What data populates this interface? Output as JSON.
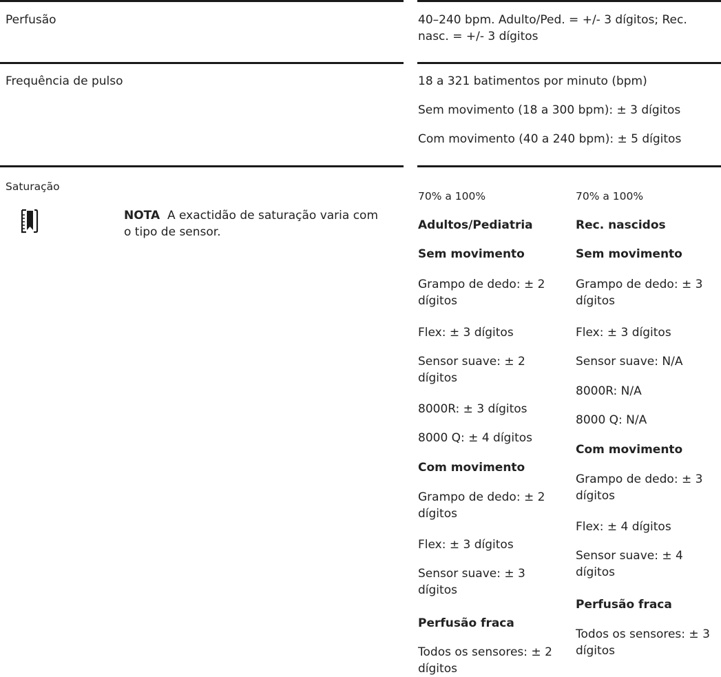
{
  "rows": {
    "perfusion": {
      "label": "Perfusão",
      "value": [
        "40–240 bpm. Adulto/Ped. = +/- 3 dígitos; Rec.",
        "nasc. = +/- 3 dígitos"
      ]
    },
    "pulse": {
      "label": "Frequência de pulso",
      "values": [
        "18 a 321 batimentos por minuto (bpm)",
        "Sem movimento (18 a 300 bpm): ± 3 dígitos",
        "Com movimento (40 a 240 bpm): ± 5 dígitos"
      ]
    },
    "saturation": {
      "label": "Saturação",
      "note": {
        "icon": "note-book-icon",
        "keyword": "NOTA",
        "text_line1": "A exactidão de saturação varia com",
        "text_line2": "o tipo de sensor."
      },
      "adult": {
        "range": "70% a 100%",
        "heading": "Adultos/Pediatria",
        "no_motion": {
          "heading": "Sem movimento",
          "finger_clip": [
            "Grampo de dedo: ± 2",
            "dígitos"
          ],
          "flex": "Flex: ± 3 dígitos",
          "soft_sensor": [
            "Sensor suave: ± 2",
            "dígitos"
          ],
          "r8000": "8000R: ± 3 dígitos",
          "q8000": "8000 Q: ± 4 dígitos"
        },
        "motion": {
          "heading": "Com movimento",
          "finger_clip": [
            "Grampo de dedo: ± 2",
            "dígitos"
          ],
          "flex": "Flex: ± 3 dígitos",
          "soft_sensor": [
            "Sensor suave: ± 3",
            "dígitos"
          ]
        },
        "low_perfusion": {
          "heading": "Perfusão fraca",
          "all_sensors": [
            "Todos os sensores: ± 2",
            "dígitos"
          ]
        }
      },
      "neonate": {
        "range": "70% a 100%",
        "heading": "Rec. nascidos",
        "no_motion": {
          "heading": "Sem movimento",
          "finger_clip": [
            "Grampo de dedo: ± 3",
            "dígitos"
          ],
          "flex": "Flex: ± 3 dígitos",
          "soft_sensor": "Sensor suave: N/A",
          "r8000": "8000R: N/A",
          "q8000": "8000 Q: N/A"
        },
        "motion": {
          "heading": "Com movimento",
          "finger_clip": [
            "Grampo de dedo: ± 3",
            "dígitos"
          ],
          "flex": "Flex: ± 4 dígitos",
          "soft_sensor": [
            "Sensor suave: ± 4",
            "dígitos"
          ]
        },
        "low_perfusion": {
          "heading": "Perfusão fraca",
          "all_sensors": [
            "Todos os sensores: ± 3",
            "dígitos"
          ]
        }
      }
    }
  }
}
